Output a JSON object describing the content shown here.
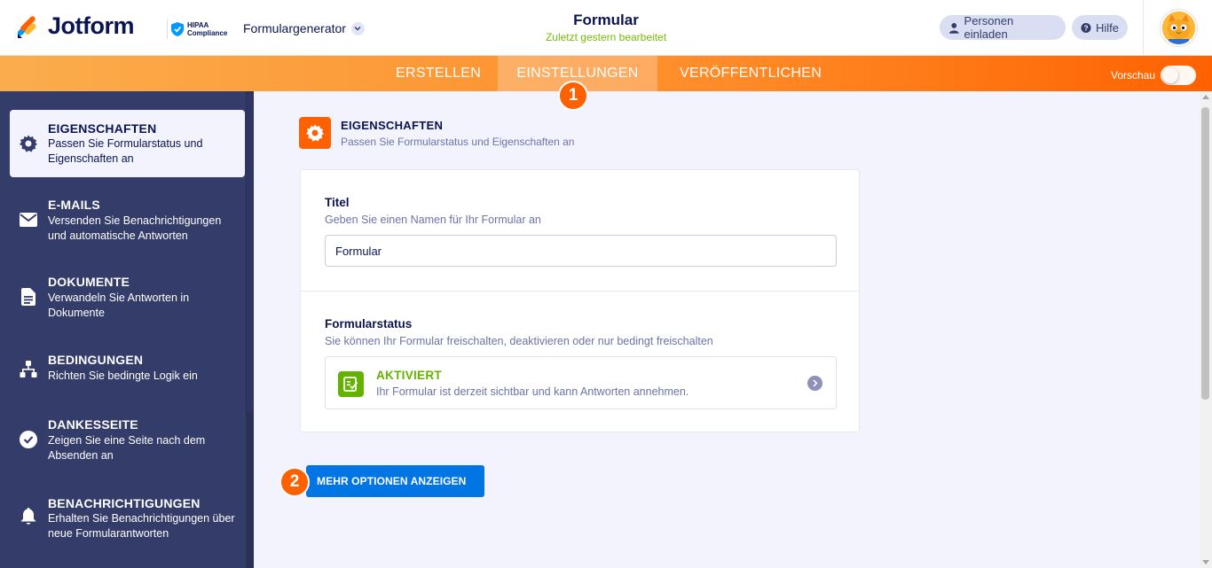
{
  "header": {
    "brand": "Jotform",
    "hipaa_line1": "HIPAA",
    "hipaa_line2": "Compliance",
    "product_switch": "Formulargenerator",
    "form_title": "Formular",
    "form_subtitle": "Zuletzt gestern bearbeitet",
    "invite_label": "Personen einladen",
    "help_label": "Hilfe"
  },
  "nav": {
    "tabs": [
      {
        "label": "ERSTELLEN",
        "active": false
      },
      {
        "label": "EINSTELLUNGEN",
        "active": true
      },
      {
        "label": "VERÖFFENTLICHEN",
        "active": false
      }
    ],
    "preview_label": "Vorschau",
    "preview_on": false
  },
  "annotations": {
    "step1": "1",
    "step2": "2"
  },
  "sidebar": {
    "items": [
      {
        "title": "EIGENSCHAFTEN",
        "desc": "Passen Sie Formularstatus und Eigenschaften an",
        "icon": "gear-icon",
        "active": true
      },
      {
        "title": "E-MAILS",
        "desc": "Versenden Sie Benachrichtigungen und automatische Antworten",
        "icon": "envelope-icon",
        "active": false
      },
      {
        "title": "DOKUMENTE",
        "desc": "Verwandeln Sie Antworten in Dokumente",
        "icon": "document-icon",
        "active": false
      },
      {
        "title": "BEDINGUNGEN",
        "desc": "Richten Sie bedingte Logik ein",
        "icon": "hierarchy-icon",
        "active": false
      },
      {
        "title": "DANKESSEITE",
        "desc": "Zeigen Sie eine Seite nach dem Absenden an",
        "icon": "check-circle-icon",
        "active": false
      },
      {
        "title": "BENACHRICHTIGUNGEN",
        "desc": "Erhalten Sie Benachrichtigungen über neue Formularantworten",
        "icon": "bell-icon",
        "active": false
      }
    ]
  },
  "section": {
    "title": "EIGENSCHAFTEN",
    "subtitle": "Passen Sie Formularstatus und Eigenschaften an"
  },
  "form": {
    "title_label": "Titel",
    "title_hint": "Geben Sie einen Namen für Ihr Formular an",
    "title_value": "Formular",
    "status_label": "Formularstatus",
    "status_hint": "Sie können Ihr Formular freischalten, deaktivieren oder nur bedingt freischalten",
    "status_value": "AKTIVIERT",
    "status_desc": "Ihr Formular ist derzeit sichtbar und kann Antworten annehmen."
  },
  "actions": {
    "more_options": "MEHR OPTIONEN ANZEIGEN"
  },
  "colors": {
    "accent": "#ff6100",
    "navy": "#0a1551",
    "sidebar_bg": "#343c6a",
    "active_green": "#64b200",
    "button_blue": "#0075e3"
  }
}
